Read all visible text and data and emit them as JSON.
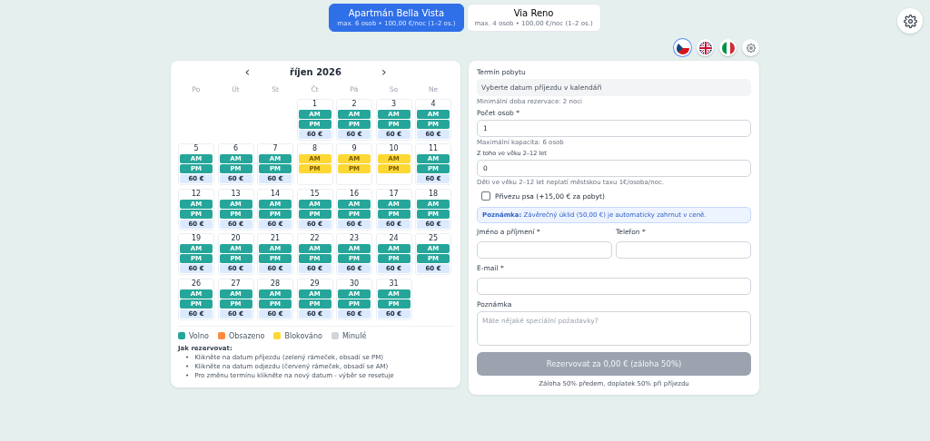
{
  "property_tabs": [
    {
      "name": "Apartmán Bella Vista",
      "details": "max. 6 osob • 100,00 €/noc (1–2 os.)",
      "selected": true
    },
    {
      "name": "Via Reno",
      "details": "max. 4 osob • 100,00 €/noc (1–2 os.)",
      "selected": false
    }
  ],
  "languages": [
    {
      "kind": "cz",
      "selected": true
    },
    {
      "kind": "uk",
      "selected": false
    },
    {
      "kind": "it",
      "selected": false
    }
  ],
  "calendar": {
    "prev": "‹",
    "month": "říjen 2026",
    "next": "›",
    "weekdays": [
      "Po",
      "Út",
      "St",
      "Čt",
      "Pá",
      "So",
      "Ne"
    ],
    "days": [
      {
        "kind": "empty"
      },
      {
        "kind": "empty"
      },
      {
        "kind": "empty"
      },
      {
        "kind": "day",
        "day": "1",
        "am": "AM",
        "pm": "PM",
        "blocked": false,
        "price": "60 €"
      },
      {
        "kind": "day",
        "day": "2",
        "am": "AM",
        "pm": "PM",
        "blocked": false,
        "price": "60 €"
      },
      {
        "kind": "day",
        "day": "3",
        "am": "AM",
        "pm": "PM",
        "blocked": false,
        "price": "60 €"
      },
      {
        "kind": "day",
        "day": "4",
        "am": "AM",
        "pm": "PM",
        "blocked": false,
        "price": "60 €"
      },
      {
        "kind": "day",
        "day": "5",
        "am": "AM",
        "pm": "PM",
        "blocked": false,
        "price": "60 €"
      },
      {
        "kind": "day",
        "day": "6",
        "am": "AM",
        "pm": "PM",
        "blocked": false,
        "price": "60 €"
      },
      {
        "kind": "day",
        "day": "7",
        "am": "AM",
        "pm": "PM",
        "blocked": false,
        "price": "60 €"
      },
      {
        "kind": "day",
        "day": "8",
        "am": "AM",
        "pm": "PM",
        "blocked": true
      },
      {
        "kind": "day",
        "day": "9",
        "am": "AM",
        "pm": "PM",
        "blocked": true
      },
      {
        "kind": "day",
        "day": "10",
        "am": "AM",
        "pm": "PM",
        "blocked": true
      },
      {
        "kind": "day",
        "day": "11",
        "am": "AM",
        "pm": "PM",
        "blocked": false,
        "price": "60 €"
      },
      {
        "kind": "day",
        "day": "12",
        "am": "AM",
        "pm": "PM",
        "blocked": false,
        "price": "60 €"
      },
      {
        "kind": "day",
        "day": "13",
        "am": "AM",
        "pm": "PM",
        "blocked": false,
        "price": "60 €"
      },
      {
        "kind": "day",
        "day": "14",
        "am": "AM",
        "pm": "PM",
        "blocked": false,
        "price": "60 €"
      },
      {
        "kind": "day",
        "day": "15",
        "am": "AM",
        "pm": "PM",
        "blocked": false,
        "price": "60 €"
      },
      {
        "kind": "day",
        "day": "16",
        "am": "AM",
        "pm": "PM",
        "blocked": false,
        "price": "60 €"
      },
      {
        "kind": "day",
        "day": "17",
        "am": "AM",
        "pm": "PM",
        "blocked": false,
        "price": "60 €"
      },
      {
        "kind": "day",
        "day": "18",
        "am": "AM",
        "pm": "PM",
        "blocked": false,
        "price": "60 €"
      },
      {
        "kind": "day",
        "day": "19",
        "am": "AM",
        "pm": "PM",
        "blocked": false,
        "price": "60 €"
      },
      {
        "kind": "day",
        "day": "20",
        "am": "AM",
        "pm": "PM",
        "blocked": false,
        "price": "60 €"
      },
      {
        "kind": "day",
        "day": "21",
        "am": "AM",
        "pm": "PM",
        "blocked": false,
        "price": "60 €"
      },
      {
        "kind": "day",
        "day": "22",
        "am": "AM",
        "pm": "PM",
        "blocked": false,
        "price": "60 €"
      },
      {
        "kind": "day",
        "day": "23",
        "am": "AM",
        "pm": "PM",
        "blocked": false,
        "price": "60 €"
      },
      {
        "kind": "day",
        "day": "24",
        "am": "AM",
        "pm": "PM",
        "blocked": false,
        "price": "60 €"
      },
      {
        "kind": "day",
        "day": "25",
        "am": "AM",
        "pm": "PM",
        "blocked": false,
        "price": "60 €"
      },
      {
        "kind": "day",
        "day": "26",
        "am": "AM",
        "pm": "PM",
        "blocked": false,
        "price": "60 €"
      },
      {
        "kind": "day",
        "day": "27",
        "am": "AM",
        "pm": "PM",
        "blocked": false,
        "price": "60 €"
      },
      {
        "kind": "day",
        "day": "28",
        "am": "AM",
        "pm": "PM",
        "blocked": false,
        "price": "60 €"
      },
      {
        "kind": "day",
        "day": "29",
        "am": "AM",
        "pm": "PM",
        "blocked": false,
        "price": "60 €"
      },
      {
        "kind": "day",
        "day": "30",
        "am": "AM",
        "pm": "PM",
        "blocked": false,
        "price": "60 €"
      },
      {
        "kind": "day",
        "day": "31",
        "am": "AM",
        "pm": "PM",
        "blocked": false,
        "price": "60 €"
      }
    ],
    "legend": [
      {
        "label": "Volno",
        "color": "#26a69a"
      },
      {
        "label": "Obsazeno",
        "color": "#ff8a3d"
      },
      {
        "label": "Blokováno",
        "color": "#fdd835"
      },
      {
        "label": "Minulé",
        "color": "#d1d5db"
      }
    ],
    "help_title": "Jak rezervovat:",
    "help_items": [
      {
        "bullet": "•",
        "text": "Klikněte na datum příjezdu (zelený rámeček, obsadí se PM)"
      },
      {
        "bullet": "•",
        "text": "Klikněte na datum odjezdu (červený rámeček, obsadí se AM)"
      },
      {
        "bullet": "•",
        "text": "Pro změnu termínu klikněte na nový datum - výběr se resetuje"
      }
    ]
  },
  "form": {
    "stay_label": "Termín pobytu",
    "stay_value": "Vyberte datum příjezdu v kalendáři",
    "stay_hint": "Minimální doba rezervace: 2 noci",
    "guests_label": "Počet osob *",
    "guests_value": "1",
    "guests_hint": "Maximální kapacita: 6 osob",
    "children_label": "Z toho ve věku 2–12 let",
    "children_value": "0",
    "children_hint": "Děti ve věku 2–12 let neplatí městskou taxu 1€/osoba/noc.",
    "dog_label": "Přivezu psa (+15,00 € za pobyt)",
    "dog_checked": false,
    "note": "**Poznámka:** Závěrečný úklid (50,00 €) je automaticky zahrnut v ceně.",
    "name_label": "Jméno a příjmení *",
    "phone_label": "Telefon *",
    "email_label": "E-mail *",
    "remark_label": "Poznámka",
    "remark_placeholder": "Máte nějaké speciální požadavky?",
    "submit": "Rezervovat za 0,00 € (záloha 50%)",
    "submit_disabled": true,
    "footer": "Záloha 50% předem, doplatek 50% při příjezdu"
  }
}
